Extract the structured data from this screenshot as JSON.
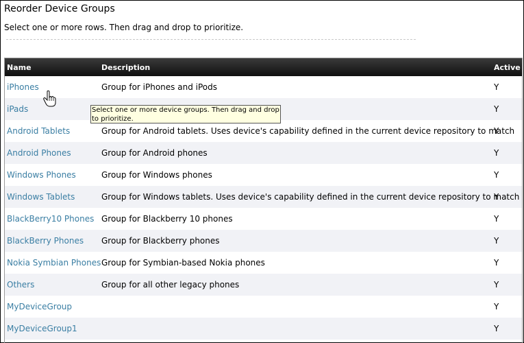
{
  "page": {
    "title": "Reorder Device Groups",
    "instructions": "Select one or more rows. Then drag and drop to prioritize."
  },
  "table": {
    "columns": [
      "Name",
      "Description",
      "Active"
    ],
    "rows": [
      {
        "name": "iPhones",
        "description": "Group for iPhones and iPods",
        "active": "Y"
      },
      {
        "name": "iPads",
        "description": "",
        "active": "Y"
      },
      {
        "name": "Android Tablets",
        "description": "Group for Android tablets. Uses device's capability defined in the current device repository to match",
        "active": "Y"
      },
      {
        "name": "Android Phones",
        "description": "Group for Android phones",
        "active": "Y"
      },
      {
        "name": "Windows Phones",
        "description": "Group for Windows phones",
        "active": "Y"
      },
      {
        "name": "Windows Tablets",
        "description": "Group for Windows tablets. Uses device's capability defined in the current device repository to match",
        "active": "Y"
      },
      {
        "name": "BlackBerry10 Phones",
        "description": "Group for Blackberry 10 phones",
        "active": "Y"
      },
      {
        "name": "BlackBerry Phones",
        "description": "Group for Blackberry phones",
        "active": "Y"
      },
      {
        "name": "Nokia Symbian Phones",
        "description": "Group for Symbian-based Nokia phones",
        "active": "Y"
      },
      {
        "name": "Others",
        "description": "Group for all other legacy phones",
        "active": "Y"
      },
      {
        "name": "MyDeviceGroup",
        "description": "",
        "active": "Y"
      },
      {
        "name": "MyDeviceGroup1",
        "description": "",
        "active": "Y"
      }
    ]
  },
  "tooltip": {
    "text": "Select one or more device groups. Then drag and drop to prioritize."
  },
  "icons": {
    "cursor": "hand-pointer-icon"
  }
}
